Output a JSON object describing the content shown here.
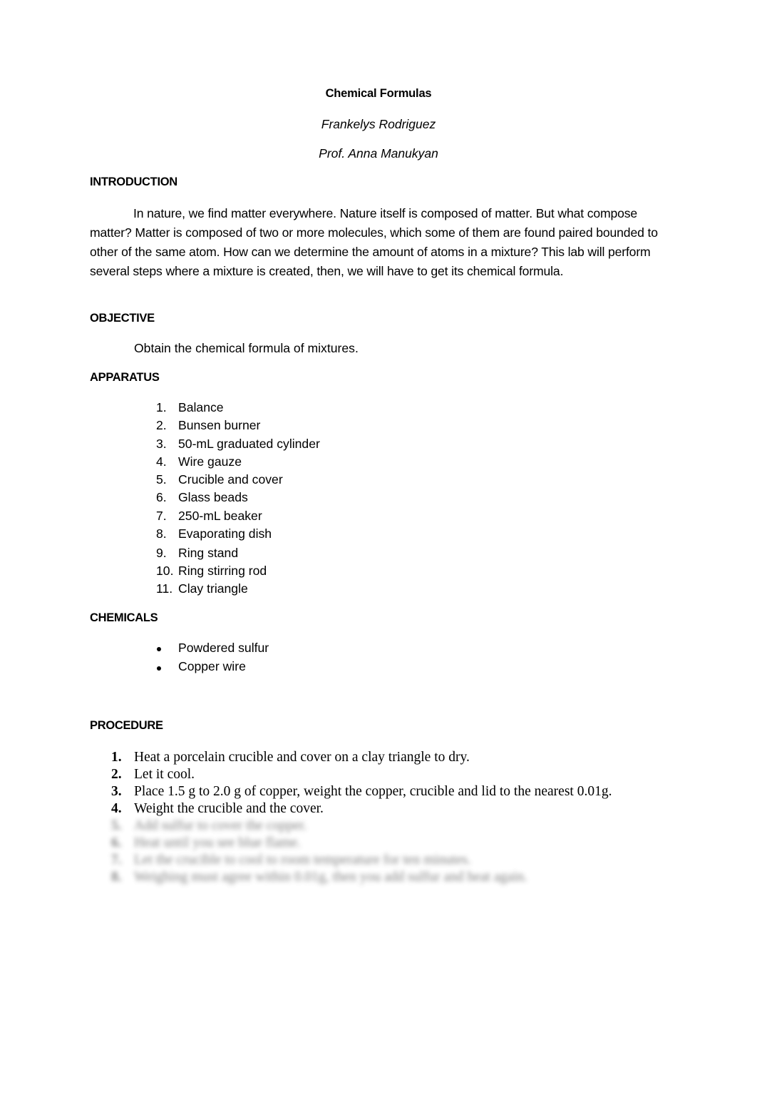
{
  "document": {
    "title": "Chemical Formulas",
    "author": "Frankelys Rodriguez",
    "professor": "Prof. Anna Manukyan"
  },
  "introduction": {
    "heading": "INTRODUCTION",
    "text": "In nature, we find matter everywhere. Nature itself is composed of matter. But what compose matter? Matter is composed of two or more molecules, which some of them are found paired bounded to other of the same atom. How can we determine the amount of atoms in a mixture? This lab will perform several steps where a mixture is created, then, we will have to get its chemical formula."
  },
  "objective": {
    "heading": "OBJECTIVE",
    "text": "Obtain the chemical formula of mixtures."
  },
  "apparatus": {
    "heading": "APPARATUS",
    "items": [
      {
        "num": "1.",
        "text": "Balance"
      },
      {
        "num": "2.",
        "text": "Bunsen burner"
      },
      {
        "num": "3.",
        "text": "50-mL graduated cylinder"
      },
      {
        "num": "4.",
        "text": "Wire gauze"
      },
      {
        "num": "5.",
        "text": "Crucible and cover"
      },
      {
        "num": "6.",
        "text": "Glass beads"
      },
      {
        "num": "7.",
        "text": "250-mL beaker"
      },
      {
        "num": "8.",
        "text": "Evaporating dish"
      },
      {
        "num": "9.",
        "text": "Ring stand"
      },
      {
        "num": "10.",
        "text": "Ring stirring rod"
      },
      {
        "num": "11.",
        "text": "Clay triangle"
      }
    ]
  },
  "chemicals": {
    "heading": "CHEMICALS",
    "items": [
      "Powdered sulfur",
      "Copper wire"
    ]
  },
  "procedure": {
    "heading": "PROCEDURE",
    "steps": [
      {
        "num": "1.",
        "text": "Heat a porcelain crucible and cover on a clay triangle to dry."
      },
      {
        "num": "2.",
        "text": "Let it cool."
      },
      {
        "num": "3.",
        "text": "Place 1.5 g to 2.0 g of copper, weight the copper, crucible and lid to the nearest 0.01g."
      },
      {
        "num": "4.",
        "text": "Weight the crucible and the cover."
      }
    ],
    "blurred_steps": [
      {
        "num": "5.",
        "text": "Add sulfur to cover the copper."
      },
      {
        "num": "6.",
        "text": "Heat until you see blue flame."
      },
      {
        "num": "7.",
        "text": "Let the crucible to cool to room temperature for ten minutes."
      },
      {
        "num": "8.",
        "text": "Weighing must agree within 0.01g, then you add sulfur and heat again."
      }
    ]
  }
}
